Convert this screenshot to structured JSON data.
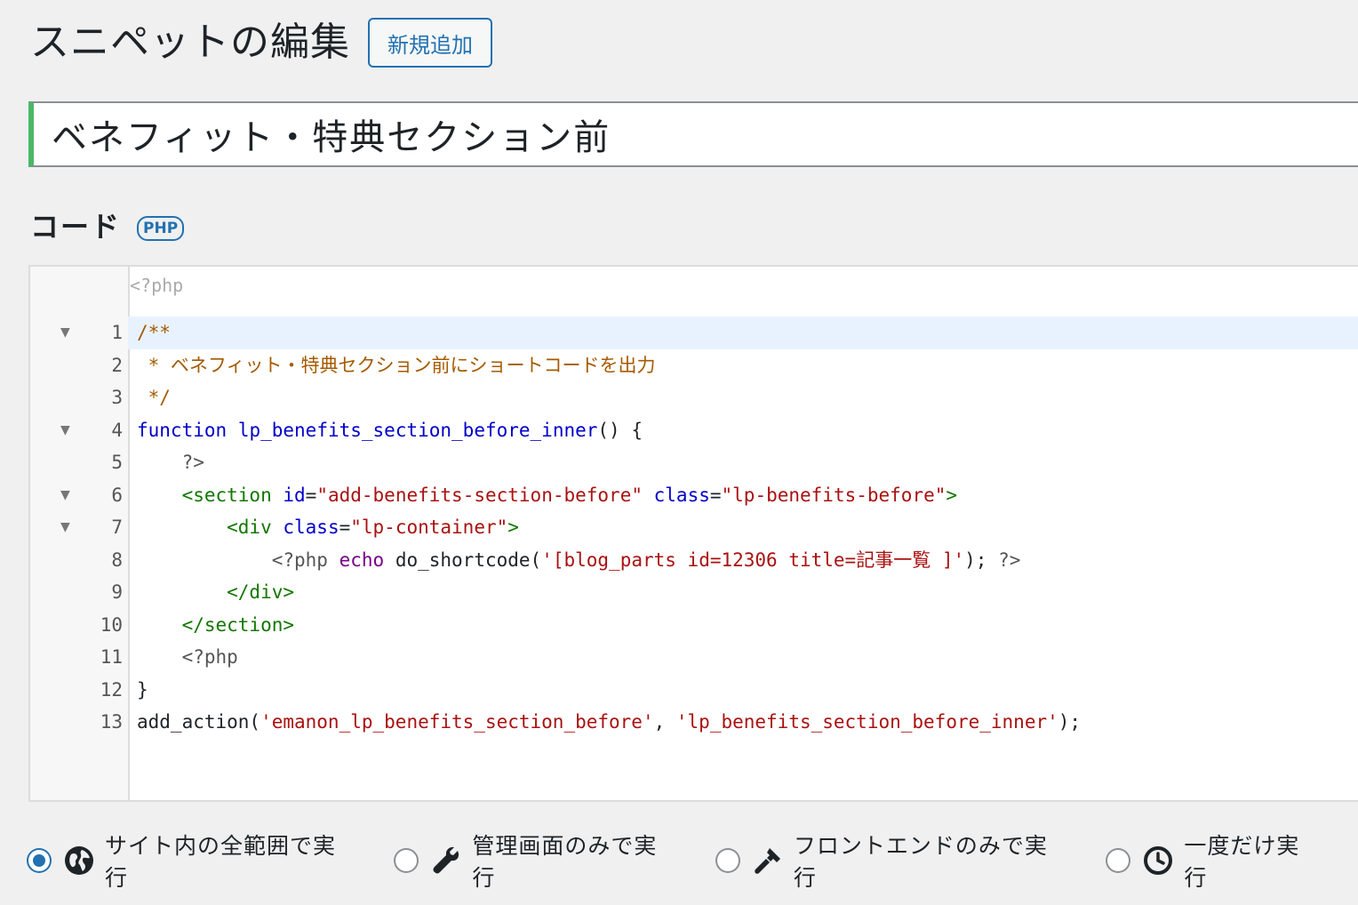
{
  "header": {
    "title": "スニペットの編集",
    "add_new_label": "新規追加"
  },
  "snippet_title": "ベネフィット・特典セクション前",
  "code_section": {
    "label": "コード",
    "badge": "PHP"
  },
  "editor": {
    "prelude": "<?php",
    "lines": [
      {
        "n": "1",
        "fold": true,
        "active": true,
        "tokens": [
          {
            "t": "/**",
            "c": "comment"
          }
        ]
      },
      {
        "n": "2",
        "fold": false,
        "tokens": [
          {
            "t": " * ベネフィット・特典セクション前にショートコードを出力",
            "c": "comment"
          }
        ]
      },
      {
        "n": "3",
        "fold": false,
        "tokens": [
          {
            "t": " */",
            "c": "comment"
          }
        ]
      },
      {
        "n": "4",
        "fold": true,
        "tokens": [
          {
            "t": "function",
            "c": "keyword"
          },
          {
            "t": " ",
            "c": "plain"
          },
          {
            "t": "lp_benefits_section_before_inner",
            "c": "def"
          },
          {
            "t": "() {",
            "c": "plain"
          }
        ]
      },
      {
        "n": "5",
        "fold": false,
        "tokens": [
          {
            "t": "    ?>",
            "c": "meta"
          }
        ]
      },
      {
        "n": "6",
        "fold": true,
        "tokens": [
          {
            "t": "    <section",
            "c": "tag"
          },
          {
            "t": " ",
            "c": "plain"
          },
          {
            "t": "id",
            "c": "attr"
          },
          {
            "t": "=",
            "c": "plain"
          },
          {
            "t": "\"add-benefits-section-before\"",
            "c": "string"
          },
          {
            "t": " ",
            "c": "plain"
          },
          {
            "t": "class",
            "c": "attr"
          },
          {
            "t": "=",
            "c": "plain"
          },
          {
            "t": "\"lp-benefits-before\"",
            "c": "string"
          },
          {
            "t": ">",
            "c": "tag"
          }
        ]
      },
      {
        "n": "7",
        "fold": true,
        "tokens": [
          {
            "t": "        <div",
            "c": "tag"
          },
          {
            "t": " ",
            "c": "plain"
          },
          {
            "t": "class",
            "c": "attr"
          },
          {
            "t": "=",
            "c": "plain"
          },
          {
            "t": "\"lp-container\"",
            "c": "string"
          },
          {
            "t": ">",
            "c": "tag"
          }
        ]
      },
      {
        "n": "8",
        "fold": false,
        "tokens": [
          {
            "t": "            <?php",
            "c": "meta"
          },
          {
            "t": " ",
            "c": "plain"
          },
          {
            "t": "echo",
            "c": "echo"
          },
          {
            "t": " do_shortcode(",
            "c": "plain"
          },
          {
            "t": "'[blog_parts id=12306 title=記事一覧 ]'",
            "c": "string"
          },
          {
            "t": "); ",
            "c": "plain"
          },
          {
            "t": "?>",
            "c": "meta"
          }
        ]
      },
      {
        "n": "9",
        "fold": false,
        "tokens": [
          {
            "t": "        </div>",
            "c": "tag"
          }
        ]
      },
      {
        "n": "10",
        "fold": false,
        "tokens": [
          {
            "t": "    </section>",
            "c": "tag"
          }
        ]
      },
      {
        "n": "11",
        "fold": false,
        "tokens": [
          {
            "t": "    <?php",
            "c": "meta"
          }
        ]
      },
      {
        "n": "12",
        "fold": false,
        "tokens": [
          {
            "t": "}",
            "c": "plain"
          }
        ]
      },
      {
        "n": "13",
        "fold": false,
        "tokens": [
          {
            "t": "add_action(",
            "c": "plain"
          },
          {
            "t": "'emanon_lp_benefits_section_before'",
            "c": "string"
          },
          {
            "t": ", ",
            "c": "plain"
          },
          {
            "t": "'lp_benefits_section_before_inner'",
            "c": "string"
          },
          {
            "t": ");",
            "c": "plain"
          }
        ]
      }
    ]
  },
  "scope_options": [
    {
      "id": "global",
      "label": "サイト内の全範囲で実行",
      "icon": "globe-icon",
      "checked": true
    },
    {
      "id": "admin",
      "label": "管理画面のみで実行",
      "icon": "wrench-icon",
      "checked": false
    },
    {
      "id": "front-end",
      "label": "フロントエンドのみで実行",
      "icon": "hammer-icon",
      "checked": false
    },
    {
      "id": "single-use",
      "label": "一度だけ実行",
      "icon": "clock-icon",
      "checked": false
    }
  ],
  "colors": {
    "accent": "#2271b1",
    "title_border": "#4ab866",
    "active_line": "#e8f2ff"
  }
}
